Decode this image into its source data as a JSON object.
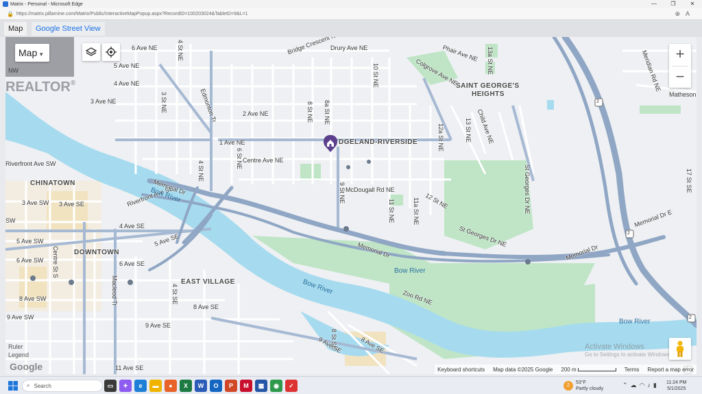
{
  "window": {
    "title": "Matrix - Personal - Microsoft Edge",
    "url": "https://matrix.pillarnine.com/Matrix/Public/InteractiveMapPopup.aspx?RecordID=100203024&TableID=9&L=1"
  },
  "tabs": [
    {
      "label": "Map",
      "active": true
    },
    {
      "label": "Google Street View",
      "active": false
    }
  ],
  "map": {
    "type_label": "Map",
    "zoom_in": "+",
    "zoom_out": "−",
    "watermark": "REALTOR",
    "watermark_mark": "®",
    "neighbourhoods": [
      "SAINT GEORGE'S",
      "HEIGHTS",
      "DGELAND-RIVERSIDE",
      "CHINATOWN",
      "DOWNTOWN",
      "EAST VILLAGE"
    ],
    "streets": [
      "Phair Ave NE",
      "Drury Ave NE",
      "Bridge Crescent NE",
      "6 Ave NE",
      "5 Ave NE",
      "4 Ave NE",
      "3 Ave NE",
      "2 Ave NE",
      "1 Ave NE",
      "Centre Ave NE",
      "McDougall Rd NE",
      "Memorial Dr",
      "Memorial Dr",
      "Memorial Dr",
      "Memorial Dr E",
      "Riverfront Ave SE",
      "Riverfront Ave SW",
      "4 Ave SE",
      "5 Ave SE",
      "6 Ave SE",
      "8 Ave SE",
      "9 Ave SE",
      "11 Ave SE",
      "3 Ave SW",
      "3 Ave SE",
      "5 Ave SW",
      "6 Ave SW",
      "8 Ave SW",
      "9 Ave SW",
      "Edmonton Tr",
      "Macleod Tr",
      "St Georges Dr NE",
      "St Georges Dr NE",
      "Zoo Rd NE",
      "Colgrove Ave NE",
      "Child Ave NE",
      "Matheson",
      "10 St NE",
      "9 St NE",
      "8 St NE",
      "8a St NE",
      "6 St NE",
      "4 St NE",
      "3 St NE",
      "4 St NE",
      "11 St NE",
      "11a St NE",
      "12 St NE",
      "12a St NE",
      "13 St NE",
      "13a St NE",
      "17 St SE",
      "Centre St S",
      "Meridian Rd NE",
      "8 St SE",
      "9 Ave SE",
      "8 Ave SE",
      "4 St SE",
      "Bow River",
      "Bow River",
      "Bow River",
      "Bow River",
      "SW",
      "NW"
    ],
    "highway_shields": [
      "2",
      "2",
      "2",
      "2"
    ],
    "left_overlay": [
      "Ruler",
      "Legend"
    ],
    "google_logo": "Google",
    "activate": {
      "line1": "Activate Windows",
      "line2": "Go to Settings to activate Windows."
    },
    "attribution": {
      "keyboard": "Keyboard shortcuts",
      "data": "Map data ©2025 Google",
      "scale": "200 m",
      "terms": "Terms",
      "report": "Report a map error"
    }
  },
  "taskbar": {
    "search_placeholder": "Search",
    "weather": {
      "temp": "53°F",
      "condition": "Partly cloudy",
      "badge": "2"
    },
    "time": "11:24 PM",
    "date": "5/1/2025"
  },
  "colors": {
    "water": "#a6dbef",
    "park": "#bfe5c6",
    "highway": "#8fa6c4",
    "road": "#ffffff",
    "accent": "#1a73e8"
  }
}
